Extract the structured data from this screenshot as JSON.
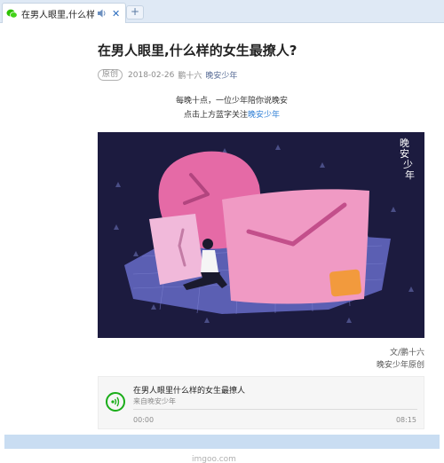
{
  "tab": {
    "title": "在男人眼里,什么样的",
    "new_tab_label": "+",
    "close_label": "✕"
  },
  "article": {
    "title": "在男人眼里,什么样的女生最撩人?",
    "badge": "原创",
    "date": "2018-02-26",
    "author": "鹏十六",
    "account": "晚安少年",
    "intro_line1": "每晚十点，一位少年陪你说晚安",
    "intro_line2_prefix": "点击上方蓝字关注",
    "intro_line2_link": "晚安少年",
    "illustration_signature": "晚安少年",
    "credit_line1": "文/鹏十六",
    "credit_line2": "晚安少年原创"
  },
  "audio": {
    "title": "在男人眼里什么样的女生最撩人",
    "from": "来自晚安少年",
    "current_time": "00:00",
    "duration": "08:15",
    "progress": 0
  },
  "watermark": "imgoo.com",
  "colors": {
    "accent_link": "#576b95",
    "wechat_green": "#1aad19",
    "illustration_bg": "#1c1b3f"
  }
}
